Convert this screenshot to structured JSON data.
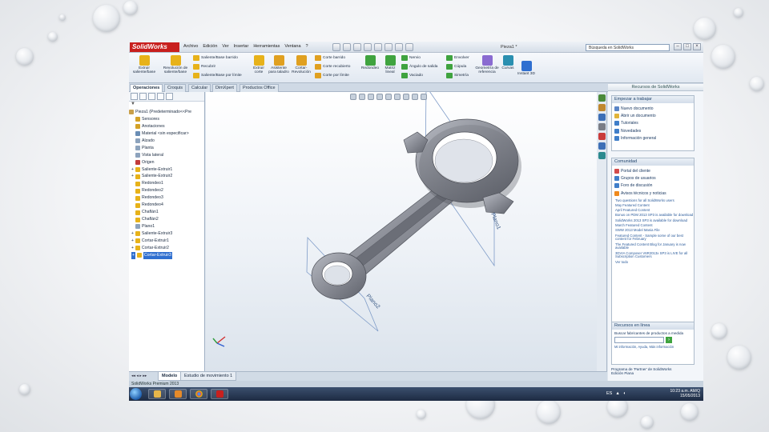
{
  "app": {
    "name": "SolidWorks",
    "brand_color": "#c8201e",
    "document_title": "Pieza1 *",
    "search_placeholder": "Búsqueda en SolidWorks",
    "menus": [
      "Archivo",
      "Edición",
      "Ver",
      "Insertar",
      "Herramientas",
      "Ventana",
      "?"
    ],
    "window_controls": [
      "–",
      "□",
      "×"
    ]
  },
  "ribbon": {
    "big_buttons": [
      {
        "label": "Extruir saliente/base",
        "icon": "extrude-boss-icon",
        "color": "#e7b21a"
      },
      {
        "label": "Revolución de saliente/base",
        "icon": "revolve-boss-icon",
        "color": "#e7b21a"
      },
      {
        "label": "Extruir corte",
        "icon": "extrude-cut-icon",
        "color": "#e7b21a"
      },
      {
        "label": "Asistente para taladro",
        "icon": "hole-wizard-icon",
        "color": "#e0a020"
      },
      {
        "label": "Cortar-Revolución",
        "icon": "revolve-cut-icon",
        "color": "#e0a020"
      },
      {
        "label": "Redondeo",
        "icon": "fillet-icon",
        "color": "#3fa33f"
      },
      {
        "label": "Matriz lineal",
        "icon": "linear-pattern-icon",
        "color": "#3fa33f"
      },
      {
        "label": "Geometría de referencia",
        "icon": "reference-geometry-icon",
        "color": "#8a6bd1"
      },
      {
        "label": "Curvas",
        "icon": "curves-icon",
        "color": "#2a8fb0"
      },
      {
        "label": "Instant 3D",
        "icon": "instant3d-icon",
        "color": "#2f6fd0"
      }
    ],
    "small_rows": [
      {
        "label": "Saliente/Base barrido",
        "icon": "swept-boss-icon",
        "color": "#e7b21a"
      },
      {
        "label": "Recubrir",
        "icon": "loft-icon",
        "color": "#e7b21a"
      },
      {
        "label": "Saliente/Base por límite",
        "icon": "boundary-boss-icon",
        "color": "#e7b21a"
      },
      {
        "label": "Corte barrido",
        "icon": "swept-cut-icon",
        "color": "#e0a020"
      },
      {
        "label": "Corte recubierto",
        "icon": "lofted-cut-icon",
        "color": "#e0a020"
      },
      {
        "label": "Corte por límite",
        "icon": "boundary-cut-icon",
        "color": "#e0a020"
      },
      {
        "label": "Nervio",
        "icon": "rib-icon",
        "color": "#3fa33f"
      },
      {
        "label": "Ángulo de salida",
        "icon": "draft-icon",
        "color": "#3fa33f"
      },
      {
        "label": "Vaciado",
        "icon": "shell-icon",
        "color": "#3fa33f"
      },
      {
        "label": "Envolver",
        "icon": "wrap-icon",
        "color": "#3fa33f"
      },
      {
        "label": "Cúpula",
        "icon": "dome-icon",
        "color": "#3fa33f"
      },
      {
        "label": "Simetría",
        "icon": "mirror-icon",
        "color": "#3fa33f"
      }
    ]
  },
  "command_tabs": [
    "Operaciones",
    "Croquis",
    "Calcular",
    "DimXpert",
    "Productos Office"
  ],
  "feature_tree": {
    "filter_icon": "filter-icon",
    "root": "Pieza1  (Predeterminado<<Pre",
    "items": [
      {
        "label": "Sensores",
        "icon": "sensor-icon",
        "color": "#d4a227"
      },
      {
        "label": "Anotaciones",
        "icon": "annotation-icon",
        "color": "#d4a227"
      },
      {
        "label": "Material <sin especificar>",
        "icon": "material-icon",
        "color": "#6a8db5"
      },
      {
        "label": "Alzado",
        "icon": "plane-icon",
        "color": "#8da3bd"
      },
      {
        "label": "Planta",
        "icon": "plane-icon",
        "color": "#8da3bd"
      },
      {
        "label": "Vista lateral",
        "icon": "plane-icon",
        "color": "#8da3bd"
      },
      {
        "label": "Origen",
        "icon": "origin-icon",
        "color": "#c23b3b"
      },
      {
        "label": "Saliente-Extruir1",
        "icon": "extrude-icon",
        "color": "#e7b21a"
      },
      {
        "label": "Saliente-Extruir2",
        "icon": "extrude-icon",
        "color": "#e7b21a"
      },
      {
        "label": "Redondeo1",
        "icon": "fillet-icon",
        "color": "#e7b21a"
      },
      {
        "label": "Redondeo2",
        "icon": "fillet-icon",
        "color": "#e7b21a"
      },
      {
        "label": "Redondeo3",
        "icon": "fillet-icon",
        "color": "#e7b21a"
      },
      {
        "label": "Redondeo4",
        "icon": "fillet-icon",
        "color": "#e7b21a"
      },
      {
        "label": "Chaflán1",
        "icon": "chamfer-icon",
        "color": "#e7b21a"
      },
      {
        "label": "Chaflán2",
        "icon": "chamfer-icon",
        "color": "#e7b21a"
      },
      {
        "label": "Plano1",
        "icon": "plane-icon",
        "color": "#8da3bd"
      },
      {
        "label": "Saliente-Extruir3",
        "icon": "extrude-icon",
        "color": "#e7b21a"
      },
      {
        "label": "Cortar-Extruir1",
        "icon": "cut-extrude-icon",
        "color": "#e7b21a"
      },
      {
        "label": "Cortar-Extruir2",
        "icon": "cut-extrude-icon",
        "color": "#e7b21a"
      },
      {
        "label": "Cortar-Extruir3",
        "icon": "cut-extrude-icon",
        "color": "#e7b21a"
      }
    ]
  },
  "viewport": {
    "plane_labels": [
      "Plano1",
      "Plano2"
    ],
    "triad_icon": "coordinate-triad-icon",
    "part_color": "#8a8d96"
  },
  "task_pane": {
    "title": "Recursos de SolidWorks",
    "start_panel": {
      "title": "Empezar a trabajar",
      "items": [
        {
          "label": "Nuevo documento",
          "icon": "new-document-icon",
          "color": "#5b85c6"
        },
        {
          "label": "Abrir un documento",
          "icon": "open-document-icon",
          "color": "#e1b33a"
        },
        {
          "label": "Tutoriales",
          "icon": "tutorial-icon",
          "color": "#3f7ec9"
        },
        {
          "label": "Novedades",
          "icon": "whats-new-icon",
          "color": "#3f7ec9"
        },
        {
          "label": "Información general",
          "icon": "info-icon",
          "color": "#3f7ec9"
        }
      ]
    },
    "community_panel": {
      "title": "Comunidad",
      "items": [
        {
          "label": "Portal del cliente",
          "icon": "portal-icon",
          "color": "#d24c4c"
        },
        {
          "label": "Grupos de usuarios",
          "icon": "user-group-icon",
          "color": "#3f7ec9"
        },
        {
          "label": "Foro de discusión",
          "icon": "forum-icon",
          "color": "#3f7ec9"
        },
        {
          "label": "Avisos técnicos y noticias",
          "icon": "rss-icon",
          "color": "#ef8a1e"
        }
      ],
      "news": [
        "Two questions for all SolidWorks users",
        "May Featured Content",
        "April Featured Content",
        "Bonus on PDM 2013 SP3 is available for download",
        "SolidWorks 2013 SP3 is available for download",
        "March Featured Content",
        "SWW 2013 Model Mania File",
        "Featured Content - Sample some of our best content for February",
        "The Featured Content Blog for January is now available",
        "3DVIA Composer V6R2013x SP3 is LIVE for all Subscription Customers"
      ],
      "more": "Ver todo"
    },
    "online_panel": {
      "title": "Recursos en línea",
      "search_label": "Buscar fabricantes de productos a medida",
      "go_icon": "go-arrow-icon",
      "privacy_text": "Mi información, Ayuda, Más información"
    },
    "footer_text": "Programa de 'Partner' de SolidWorks",
    "footer_sub": "Edición Piana"
  },
  "bottom_tabs": [
    "Modelo",
    "Estudio de movimiento 1"
  ],
  "status": "SolidWorks Premium 2013",
  "taskbar": {
    "clock_time": "10:23 a.m. AM/Q",
    "clock_date": "15/05/2013",
    "tray": "ES"
  }
}
